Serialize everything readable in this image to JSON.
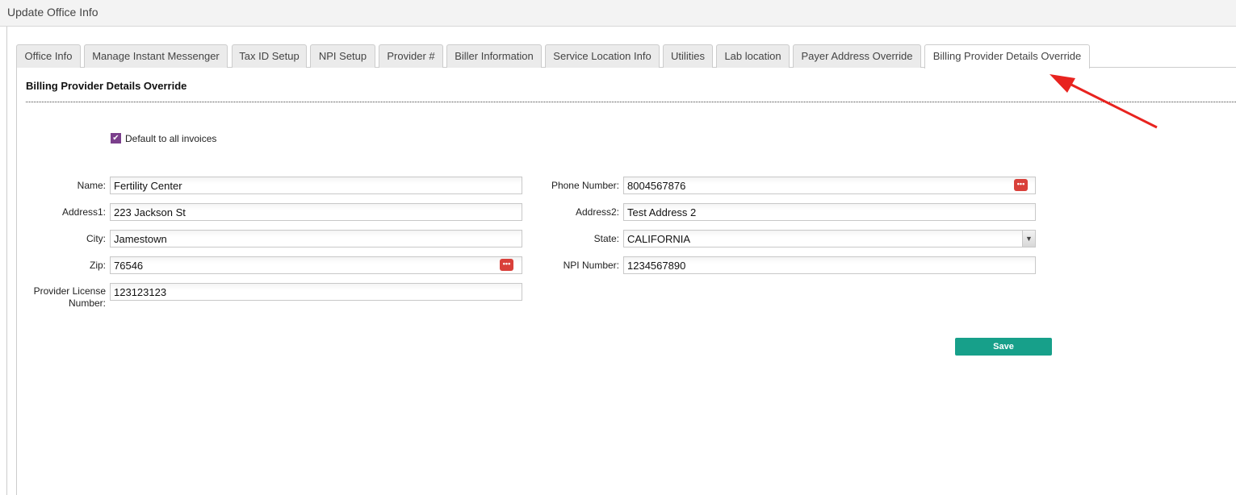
{
  "header": {
    "title": "Update Office Info"
  },
  "tabs": [
    {
      "label": "Office Info"
    },
    {
      "label": "Manage Instant Messenger"
    },
    {
      "label": "Tax ID Setup"
    },
    {
      "label": "NPI Setup"
    },
    {
      "label": "Provider #"
    },
    {
      "label": "Biller Information"
    },
    {
      "label": "Service Location Info"
    },
    {
      "label": "Utilities"
    },
    {
      "label": "Lab location"
    },
    {
      "label": "Payer Address Override"
    },
    {
      "label": "Billing Provider Details Override"
    }
  ],
  "section": {
    "title": "Billing Provider Details Override",
    "default_checkbox_label": "Default to all invoices",
    "default_checked": true
  },
  "form": {
    "name": {
      "label": "Name:",
      "value": "Fertility Center"
    },
    "address1": {
      "label": "Address1:",
      "value": "223 Jackson St"
    },
    "city": {
      "label": "City:",
      "value": "Jamestown"
    },
    "zip": {
      "label": "Zip:",
      "value": "76546"
    },
    "license": {
      "label1": "Provider License",
      "label2": "Number:",
      "value": "123123123"
    },
    "phone": {
      "label": "Phone Number:",
      "value": "8004567876"
    },
    "address2": {
      "label": "Address2:",
      "value": "Test Address 2"
    },
    "state": {
      "label": "State:",
      "value": "CALIFORNIA"
    },
    "npi": {
      "label": "NPI Number:",
      "value": "1234567890"
    }
  },
  "save_label": "Save",
  "colors": {
    "accent": "#17a08a",
    "checkbox": "#7b3f8c",
    "arrow": "#e8231f"
  }
}
